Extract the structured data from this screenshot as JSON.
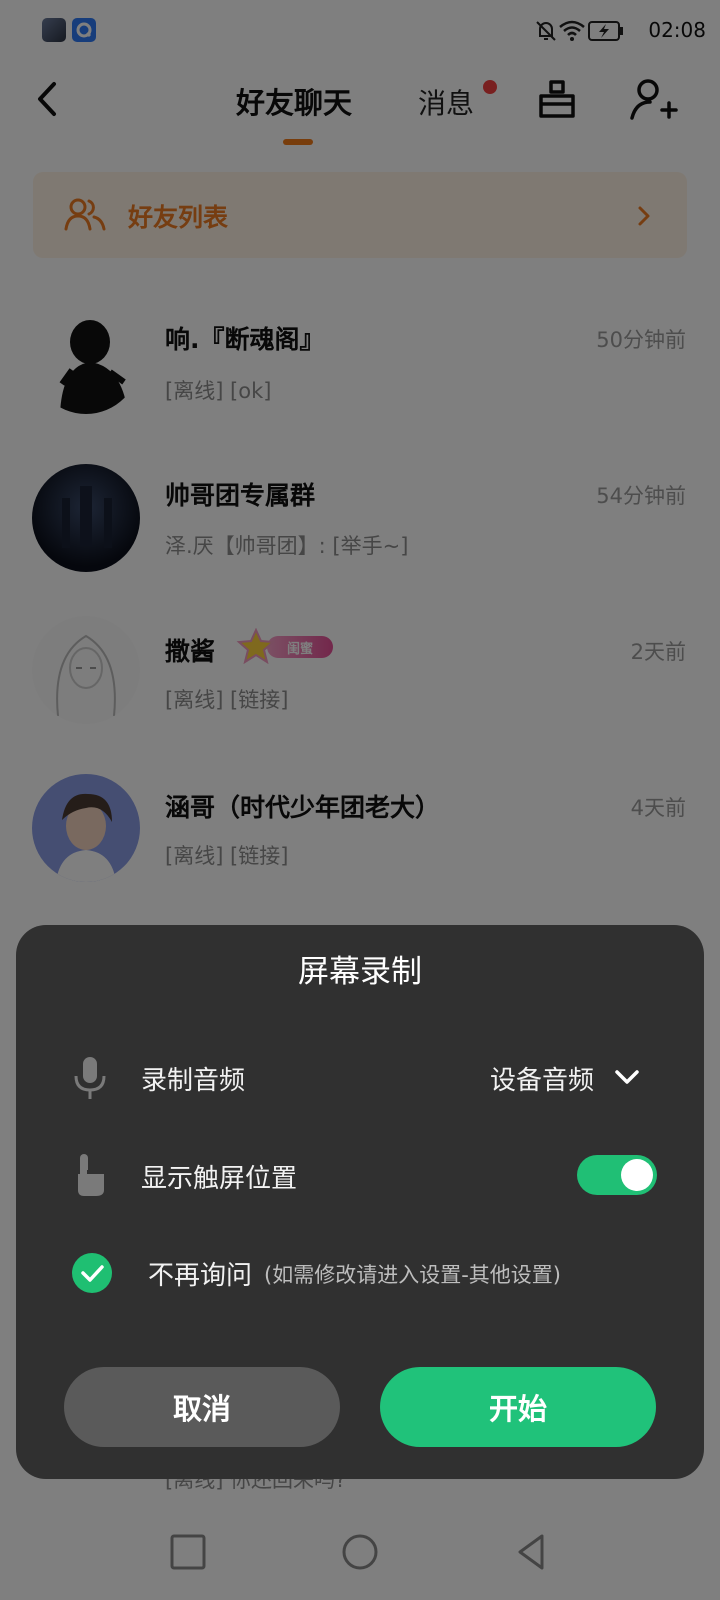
{
  "status_bar": {
    "time": "02:08",
    "icons": [
      "game-app-icon",
      "qq-app-icon",
      "mute-bell-icon",
      "wifi-icon",
      "battery-charging-icon"
    ]
  },
  "header": {
    "back_icon": "chevron-left-icon",
    "active_tab": "好友聊天",
    "messages_tab": "消息",
    "messages_has_unread": true,
    "cleanup_icon": "broom-icon",
    "add_friend_icon": "add-user-icon",
    "accent_color": "#f07a18"
  },
  "friend_list_banner": {
    "icon": "friends-icon",
    "label": "好友列表",
    "arrow_icon": "chevron-right-icon"
  },
  "chats": [
    {
      "name": "响.『断魂阁』",
      "preview": "[离线] [ok]",
      "time": "50分钟前"
    },
    {
      "name": "帅哥团专属群",
      "preview": "泽.厌【帅哥团】: [举手~]",
      "time": "54分钟前"
    },
    {
      "name": "撒酱",
      "badge": "闺蜜",
      "preview": "[离线] [链接]",
      "time": "2天前"
    },
    {
      "name": "涵哥（时代少年团老大）",
      "preview": "[离线] [链接]",
      "time": "4天前"
    },
    {
      "preview": "[离线] 你还回来吗?"
    }
  ],
  "dialog": {
    "title": "屏幕录制",
    "record_audio": {
      "icon": "microphone-icon",
      "label": "录制音频",
      "value": "设备音频",
      "dropdown_icon": "chevron-down-icon"
    },
    "show_touches": {
      "icon": "touch-hand-icon",
      "label": "显示触屏位置",
      "enabled": true
    },
    "dont_ask": {
      "checked": true,
      "label": "不再询问",
      "note": "(如需修改请进入设置-其他设置)"
    },
    "cancel_label": "取消",
    "start_label": "开始",
    "accent_color": "#20c27a"
  },
  "nav_bar": {
    "icons": [
      "recents-square-icon",
      "home-circle-icon",
      "back-triangle-icon"
    ]
  }
}
